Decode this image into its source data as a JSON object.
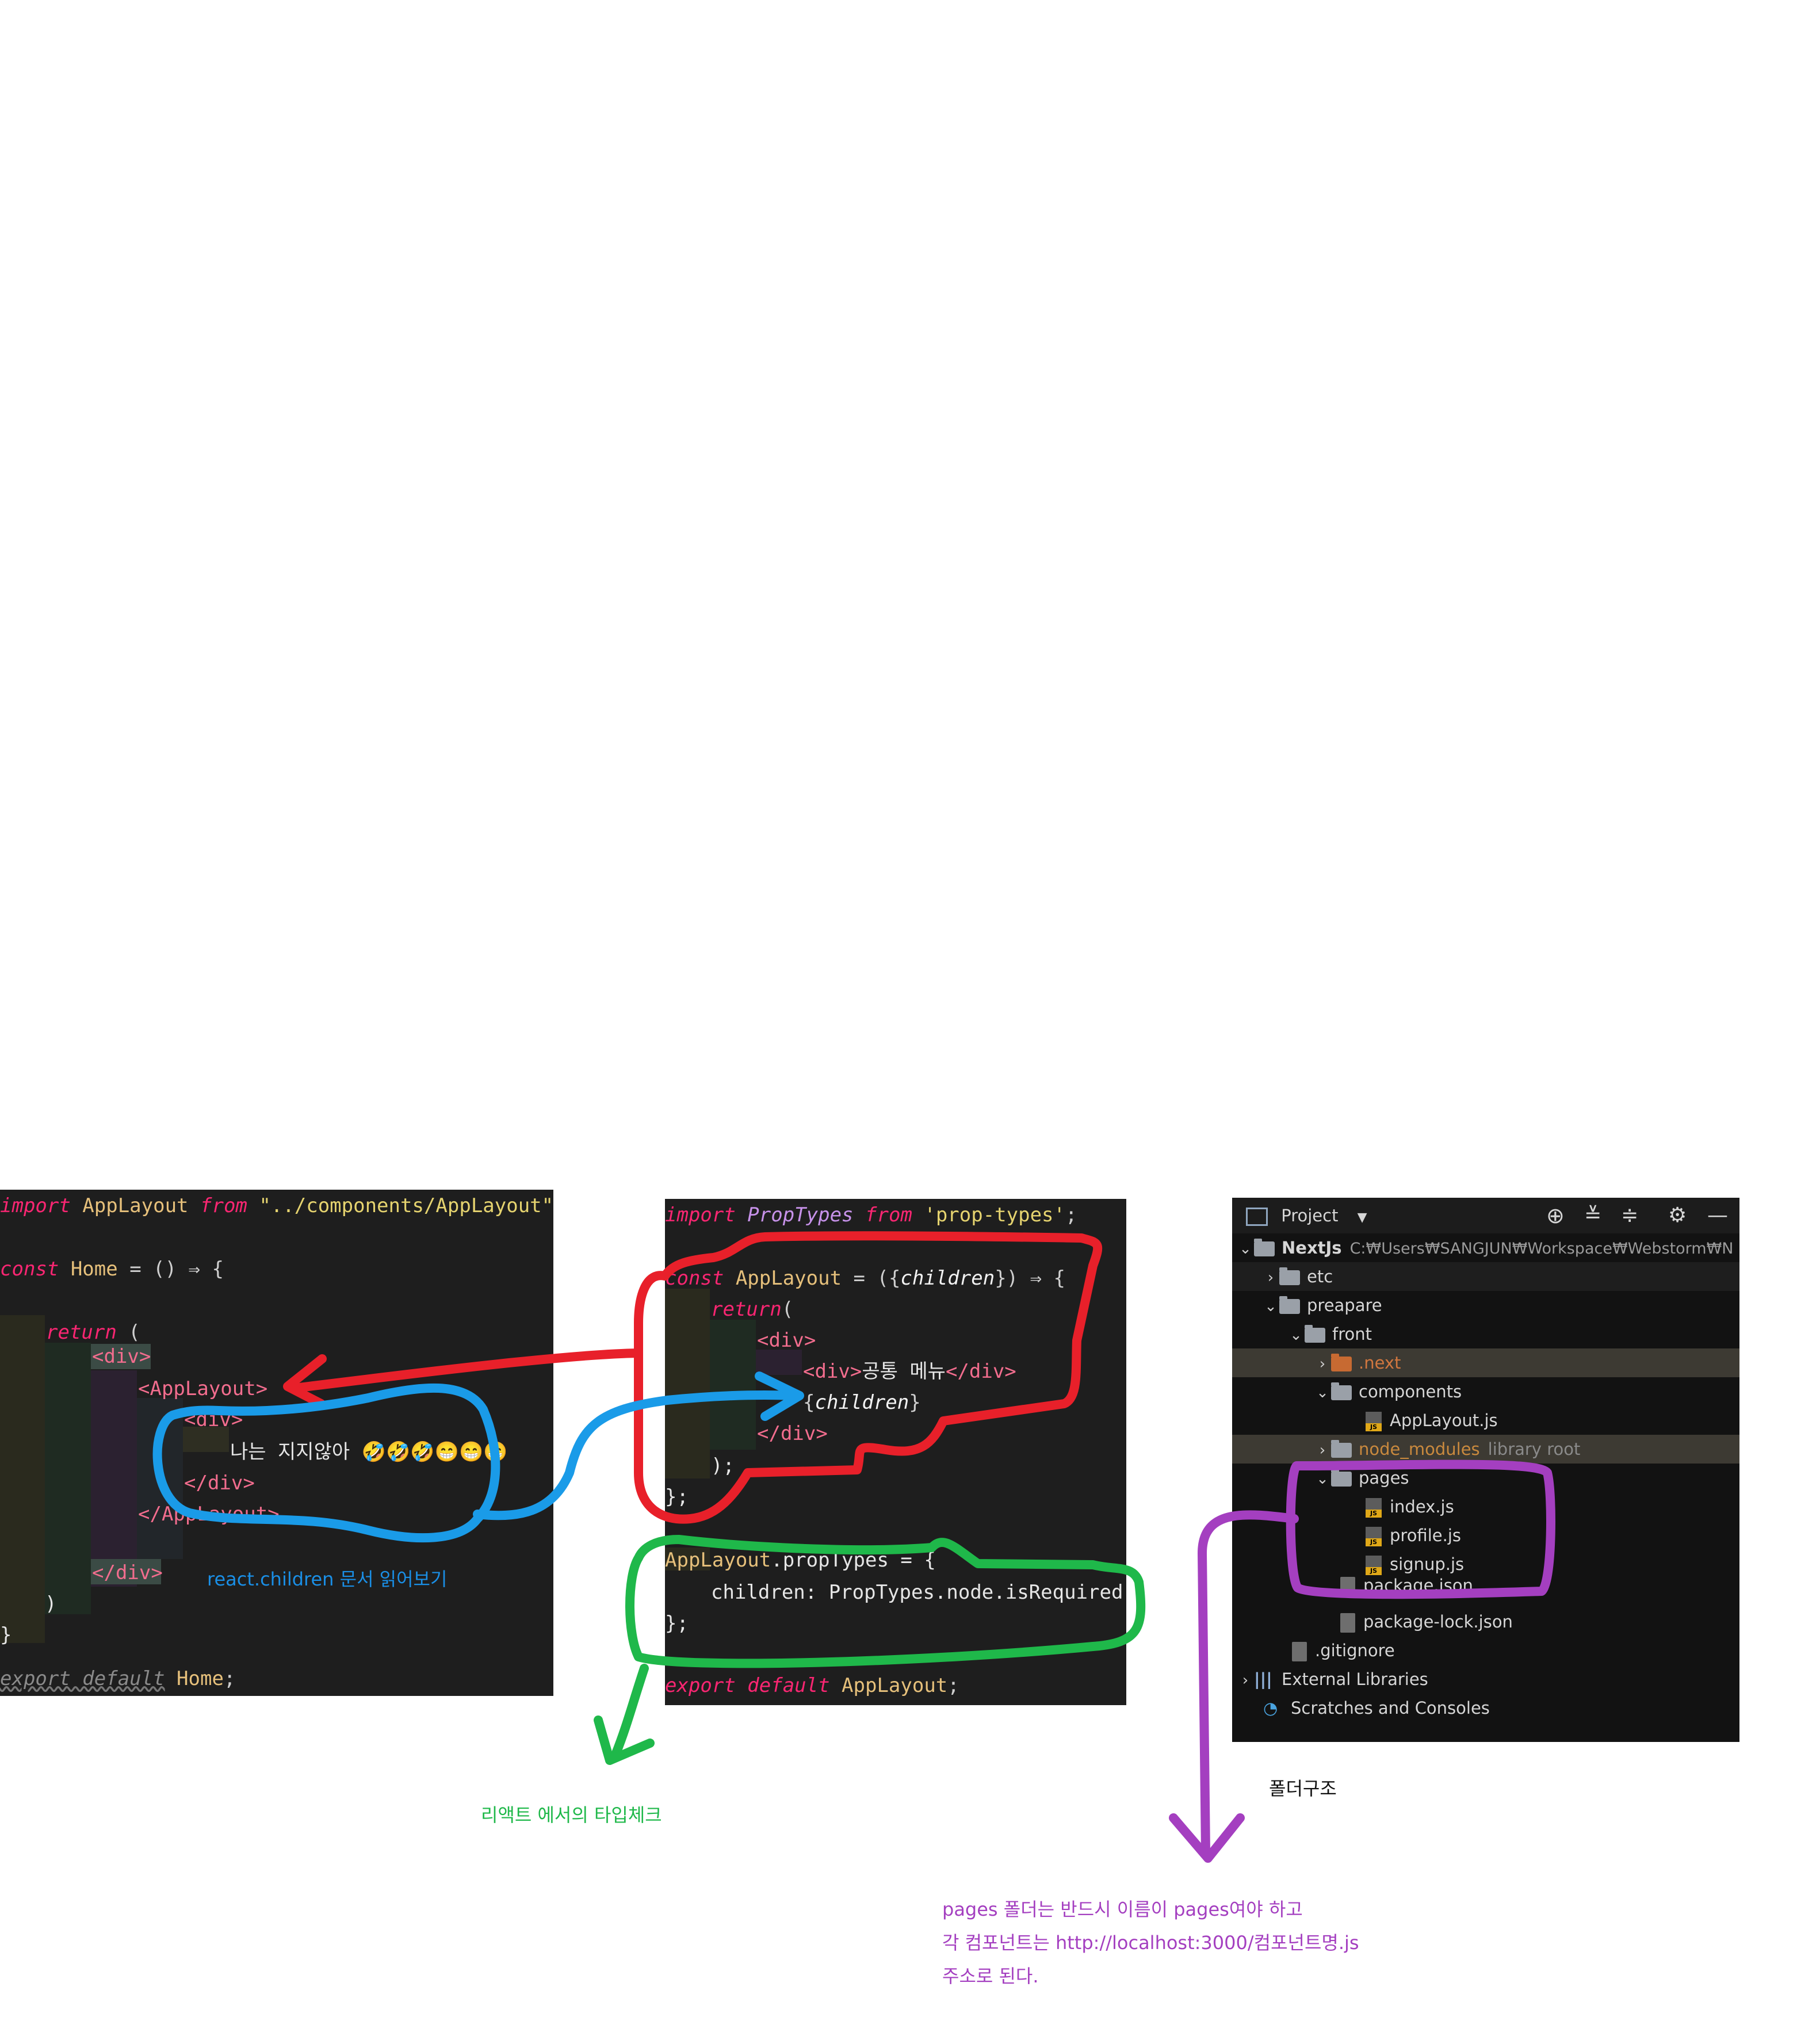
{
  "home_code": {
    "l1": {
      "kw": "import",
      "name": " AppLayout ",
      "from": "from",
      "path": " \"../components/AppLayout\"",
      "semi": ";"
    },
    "l2": {
      "kw": "const",
      "name": " Home",
      "rest": " = () ⇒ {"
    },
    "l3": {
      "kw": "return",
      "rest": " ("
    },
    "l4": {
      "tag": "<div>"
    },
    "l5": {
      "tag": "<AppLayout>"
    },
    "l6": {
      "tag": "<div>"
    },
    "l7": {
      "text": "나는 지지않아 🤣🤣🤣😁😁😁"
    },
    "l8": {
      "tag": "</div>"
    },
    "l9": {
      "tag": "</AppLayout>"
    },
    "l10": {
      "tag": "</div>"
    },
    "l11": {
      "text": ")"
    },
    "l12": {
      "text": "}"
    },
    "l13": {
      "kw": "export default",
      "name": " Home",
      "semi": ";"
    }
  },
  "applayout_code": {
    "l1": {
      "kw": "import",
      "name": " PropTypes ",
      "from": "from",
      "str": " 'prop-types'",
      "semi": ";"
    },
    "l2": {
      "kw": "const",
      "name": " AppLayout",
      "a": " = ({",
      "prm": "children",
      "b": "}) ⇒ {"
    },
    "l3": {
      "kw": "return",
      "rest": "("
    },
    "l4": {
      "tag": "<div>"
    },
    "l5": {
      "tag_open": "<div>",
      "text": "공통 메뉴",
      "tag_close": "</div>"
    },
    "l6": {
      "a": "{",
      "prm": "children",
      "b": "}"
    },
    "l7": {
      "tag": "</div>"
    },
    "l8": {
      "text": ");"
    },
    "l9": {
      "text": "};"
    },
    "l10": {
      "name": "AppLayout",
      "rest": ".propTypes = {"
    },
    "l11": {
      "text": "children: PropTypes.node.isRequired,"
    },
    "l12": {
      "text": "};"
    },
    "l13": {
      "kw": "export default",
      "name": " AppLayout",
      "semi": ";"
    }
  },
  "project": {
    "title": "Project",
    "root_name": "NextJs",
    "root_path": "C:₩Users₩SANGJUN₩Workspace₩Webstorm₩N",
    "items": {
      "etc": "etc",
      "preapare": "preapare",
      "front": "front",
      "next": ".next",
      "components": "components",
      "applayout_js": "AppLayout.js",
      "node_modules": "node_modules",
      "library_root": "library root",
      "pages": "pages",
      "index_js": "index.js",
      "profile_js": "profile.js",
      "signup_js": "signup.js",
      "package_json": "package.json",
      "package_lock_json": "package-lock.json",
      "gitignore": ".gitignore",
      "external_libraries": "External Libraries",
      "scratches": "Scratches and Consoles"
    }
  },
  "annotations": {
    "react_children": "react.children 문서 읽어보기",
    "type_check": "리액트 에서의 타입체크",
    "folder_structure": "폴더구조",
    "pages_note_1": "pages 폴더는 반드시 이름이 pages여야 하고",
    "pages_note_2": "각 컴포넌트는 http://localhost:3000/컴포넌트명.js",
    "pages_note_3": "주소로 된다."
  },
  "colors": {
    "red_marker": "#e8202a",
    "blue_marker": "#1a9be8",
    "green_marker": "#1fb84a",
    "purple_marker": "#a43fc0",
    "editor_bg": "#1e1e1e",
    "tree_bg": "#121212"
  }
}
